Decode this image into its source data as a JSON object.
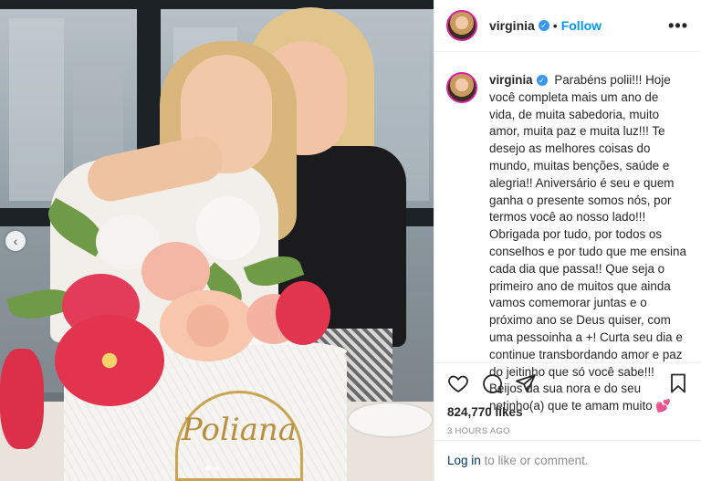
{
  "post": {
    "username": "virginia",
    "separator": "•",
    "follow_label": "Follow",
    "more_label": "•••",
    "caption": "Parabéns polii!!! Hoje você completa mais um ano de vida, de muita sabedoria, muito amor, muita paz e muita luz!!! Te desejo as melhores coisas do mundo, muitas benções, saúde e alegria!! Aniversário é seu e quem ganha o presente somos nós, por termos você ao nosso lado!!! Obrigada por tudo, por todos os conselhos e por tudo que me ensina cada dia que passa!! Que seja o primeiro ano de muitos que ainda vamos comemorar juntas e o próximo ano se Deus quiser, com uma pessoinha a +! Curta seu dia e continue transbordando amor e paz do jeitinho que só você sabe!!! Beijos da sua nora e do seu netinho(a) que te amam muito 💕",
    "likes": "824,770 likes",
    "time": "3 HOURS AGO",
    "login_link": "Log in",
    "login_text": " to like or comment."
  },
  "photo": {
    "cake_text": "Poliana",
    "carousel_total": 2,
    "carousel_active": 1
  },
  "icons": {
    "verified": "verified-badge",
    "like": "heart-icon",
    "comment": "comment-icon",
    "share": "share-icon",
    "save": "bookmark-icon",
    "prev": "chevron-left-icon"
  },
  "colors": {
    "follow": "#0095f6",
    "verified": "#3897f0",
    "link": "#003569",
    "muted": "#8e8e8e"
  }
}
